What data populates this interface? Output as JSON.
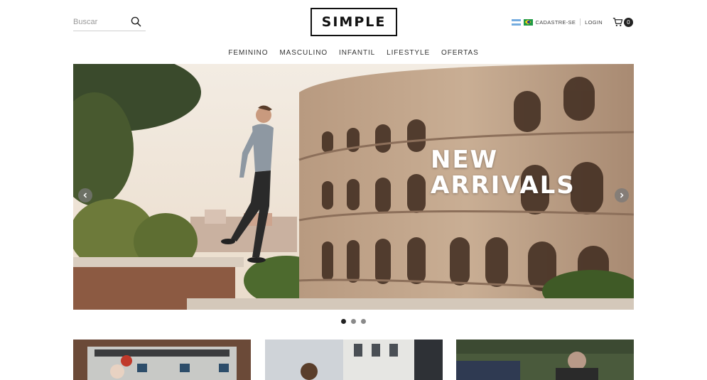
{
  "header": {
    "search": {
      "placeholder": "Buscar",
      "icon": "search-icon"
    },
    "logo": "SIMPLE",
    "top_links": {
      "register": "CADASTRE-SE",
      "login": "LOGIN"
    },
    "languages": [
      "argentina-flag-icon",
      "brazil-flag-icon"
    ],
    "cart": {
      "icon": "cart-icon",
      "count": "0"
    }
  },
  "nav": {
    "items": [
      {
        "label": "FEMININO"
      },
      {
        "label": "MASCULINO"
      },
      {
        "label": "INFANTIL"
      },
      {
        "label": "LIFESTYLE"
      },
      {
        "label": "OFERTAS"
      }
    ]
  },
  "hero": {
    "title_line1": "NEW",
    "title_line2": "ARRIVALS",
    "active_slide": 1,
    "slide_count": 3
  },
  "colors": {
    "text": "#222222",
    "nav_text": "#333333",
    "dot_active": "#222222",
    "dot_inactive": "#8a8a8a"
  }
}
